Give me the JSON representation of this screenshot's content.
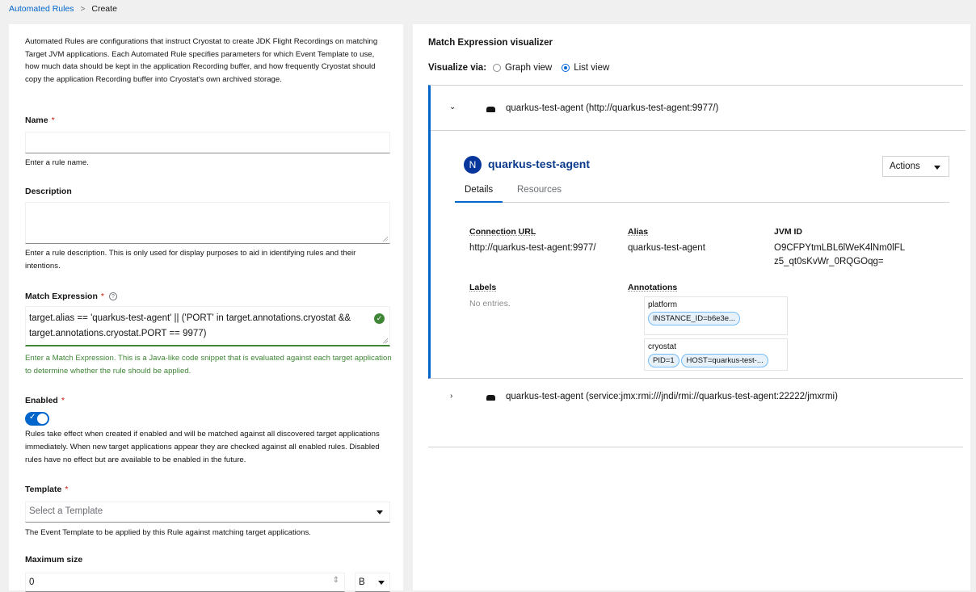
{
  "breadcrumb": {
    "parent": "Automated Rules",
    "current": "Create"
  },
  "form": {
    "intro": "Automated Rules are configurations that instruct Cryostat to create JDK Flight Recordings on matching Target JVM applications. Each Automated Rule specifies parameters for which Event Template to use, how much data should be kept in the application Recording buffer, and how frequently Cryostat should copy the application Recording buffer into Cryostat's own archived storage.",
    "required_mark": "*",
    "name": {
      "label": "Name",
      "value": "",
      "helper": "Enter a rule name."
    },
    "description": {
      "label": "Description",
      "value": "",
      "helper": "Enter a rule description. This is only used for display purposes to aid in identifying rules and their intentions."
    },
    "match_expression": {
      "label": "Match Expression",
      "value": "target.alias == 'quarkus-test-agent' || ('PORT' in target.annotations.cryostat && target.annotations.cryostat.PORT == 9977)",
      "helper": "Enter a Match Expression. This is a Java-like code snippet that is evaluated against each target application to determine whether the rule should be applied.",
      "valid": true
    },
    "enabled": {
      "label": "Enabled",
      "value": true,
      "helper": "Rules take effect when created if enabled and will be matched against all discovered target applications immediately. When new target applications appear they are checked against all enabled rules. Disabled rules have no effect but are available to be enabled in the future."
    },
    "template": {
      "label": "Template",
      "placeholder": "Select a Template",
      "helper": "The Event Template to be applied by this Rule against matching target applications."
    },
    "max_size": {
      "label": "Maximum size",
      "value": "0",
      "unit": "B"
    }
  },
  "visualizer": {
    "title": "Match Expression visualizer",
    "via_label": "Visualize via:",
    "options": [
      {
        "label": "Graph view",
        "selected": false
      },
      {
        "label": "List view",
        "selected": true
      }
    ],
    "nodes": [
      {
        "title": "quarkus-test-agent (http://quarkus-test-agent:9977/)",
        "expanded": true,
        "badge": "N",
        "name": "quarkus-test-agent",
        "actions_label": "Actions",
        "tabs": [
          "Details",
          "Resources"
        ],
        "details": {
          "connection_url_label": "Connection URL",
          "connection_url": "http://quarkus-test-agent:9977/",
          "alias_label": "Alias",
          "alias": "quarkus-test-agent",
          "jvm_id_label": "JVM ID",
          "jvm_id_line1": "O9CFPYtmLBL6lWeK4lNm0lFL",
          "jvm_id_line2": "z5_qt0sKvWr_0RQGOqg=",
          "labels_label": "Labels",
          "labels_empty": "No entries.",
          "annotations_label": "Annotations",
          "annotations": [
            {
              "group": "platform",
              "chips": [
                "INSTANCE_ID=b6e3e..."
              ]
            },
            {
              "group": "cryostat",
              "chips": [
                "PID=1",
                "HOST=quarkus-test-..."
              ]
            }
          ]
        }
      },
      {
        "title": "quarkus-test-agent (service:jmx:rmi:///jndi/rmi://quarkus-test-agent:22222/jmxrmi)",
        "expanded": false
      }
    ]
  }
}
